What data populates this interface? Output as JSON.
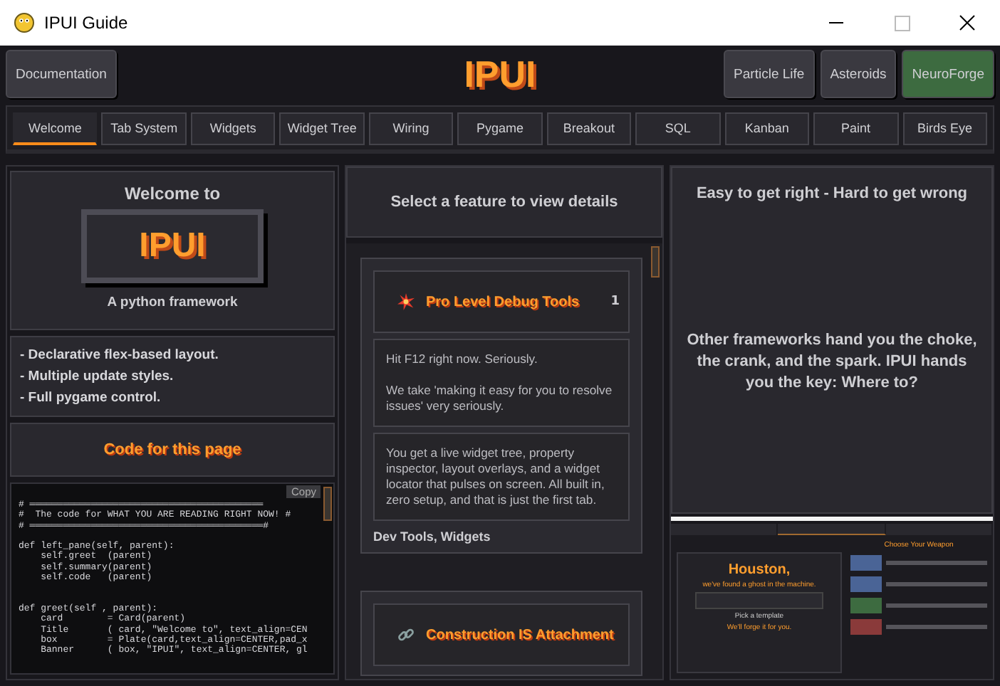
{
  "window": {
    "title": "IPUI Guide"
  },
  "header": {
    "title": "IPUI",
    "left_buttons": [
      {
        "label": "Documentation",
        "color": "#3a3940"
      }
    ],
    "right_buttons": [
      {
        "label": "Particle Life",
        "color": "#3a3940"
      },
      {
        "label": "Asteroids",
        "color": "#3a3940"
      },
      {
        "label": "NeuroForge",
        "color": "#3d6b40"
      }
    ]
  },
  "tabs": [
    {
      "label": "Welcome",
      "selected": true
    },
    {
      "label": "Tab System",
      "selected": false
    },
    {
      "label": "Widgets",
      "selected": false
    },
    {
      "label": "Widget Tree",
      "selected": false
    },
    {
      "label": "Wiring",
      "selected": false
    },
    {
      "label": "Pygame",
      "selected": false
    },
    {
      "label": "Breakout",
      "selected": false
    },
    {
      "label": "SQL",
      "selected": false
    },
    {
      "label": "Kanban",
      "selected": false
    },
    {
      "label": "Paint",
      "selected": false
    },
    {
      "label": "Birds Eye",
      "selected": false
    }
  ],
  "left": {
    "greeting": "Welcome to",
    "banner": "IPUI",
    "subtitle": "A python framework",
    "bullets": [
      "- Declarative flex-based layout.",
      "- Multiple update styles.",
      "- Full pygame control."
    ],
    "code_title": "Code for this page",
    "copy_button": "Copy",
    "code": "# ══════════════════════════════════════════\n#  The code for WHAT YOU ARE READING RIGHT NOW! #\n# ══════════════════════════════════════════#\n\ndef left_pane(self, parent):\n    self.greet  (parent)\n    self.summary(parent)\n    self.code   (parent)\n\n\ndef greet(self , parent):\n    card        = Card(parent)\n    Title       ( card, \"Welcome to\", text_align=CEN\n    box         = Plate(card,text_align=CENTER,pad_x\n    Banner      ( box, \"IPUI\", text_align=CENTER, gl"
  },
  "middle": {
    "heading": "Select a feature to view details",
    "features": [
      {
        "kind": "spark",
        "title": "Pro Level Debug Tools",
        "count": "1",
        "paragraphs": [
          "Hit F12 right now. Seriously.\n\nWe take 'making it easy for you to resolve issues' very seriously.",
          "You get a live widget tree, property inspector, layout overlays, and a widget locator that pulses on screen. All built in, zero setup, and that is just the first tab."
        ],
        "tags": "Dev Tools, Widgets"
      },
      {
        "kind": "link",
        "title": "Construction IS Attachment"
      }
    ]
  },
  "right": {
    "heading": "Easy to get right - Hard to get wrong",
    "body": "Other frameworks hand you the choke, the crank, and the spark. IPUI hands you the key: Where to?",
    "preview": {
      "headline": "Houston,",
      "subline": "we've found a ghost in the machine.",
      "prompt": "Pick a template",
      "prompt_emphasis": "We'll forge it for you.",
      "side_title": "Choose Your Weapon",
      "buttons": [
        {
          "color": "#4a6496"
        },
        {
          "color": "#4a6496"
        },
        {
          "color": "#3d6b40"
        },
        {
          "color": "#8a3a3a"
        }
      ]
    }
  }
}
